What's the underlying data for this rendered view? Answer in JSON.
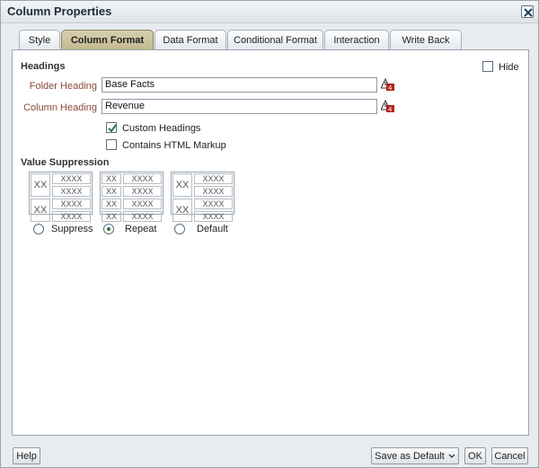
{
  "window": {
    "title": "Column Properties"
  },
  "tabs": [
    {
      "label": "Style"
    },
    {
      "label": "Column Format"
    },
    {
      "label": "Data Format"
    },
    {
      "label": "Conditional Format"
    },
    {
      "label": "Interaction"
    },
    {
      "label": "Write Back"
    }
  ],
  "active_tab": "Column Format",
  "headings": {
    "title": "Headings",
    "hide_label": "Hide",
    "hide_checked": false,
    "folder_heading_label": "Folder Heading",
    "folder_heading_value": "Base Facts",
    "column_heading_label": "Column Heading",
    "column_heading_value": "Revenue",
    "custom_headings_label": "Custom Headings",
    "custom_headings_checked": true,
    "html_markup_label": "Contains HTML Markup",
    "html_markup_checked": false
  },
  "value_suppression": {
    "title": "Value Suppression",
    "cell_xx": "XX",
    "cell_xxxx": "XXXX",
    "options": [
      {
        "label": "Suppress",
        "selected": false
      },
      {
        "label": "Repeat",
        "selected": true
      },
      {
        "label": "Default",
        "selected": false
      }
    ]
  },
  "footer": {
    "help": "Help",
    "save_default": "Save as Default",
    "ok": "OK",
    "cancel": "Cancel"
  },
  "colors": {
    "active_tab": "#c9bf97",
    "label": "#8a4a3a",
    "check_green": "#2b7a3b",
    "warn_red": "#b52020"
  }
}
